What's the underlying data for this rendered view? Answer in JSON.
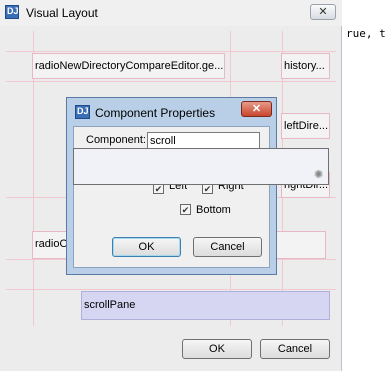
{
  "outer_dialog": {
    "title": "Visual Layout",
    "close_glyph": "✕",
    "cells": {
      "radio_new_dir": "radioNewDirectoryCompareEditor.ge...",
      "history": "history...",
      "left_dir": "leftDire...",
      "right_dir": "rightDir...",
      "radio_o": "radioO",
      "scroll_pane": "scrollPane"
    },
    "ok_label": "OK",
    "cancel_label": "Cancel"
  },
  "inner_dialog": {
    "title": "Component Properties",
    "close_glyph": "✕",
    "component_label": "Component:",
    "component_value": "scroll",
    "left_label": "Left",
    "right_label": "Right",
    "bottom_label": "Bottom",
    "ok_label": "OK",
    "cancel_label": "Cancel",
    "check_glyph": "✔",
    "icon_text": "DJ"
  },
  "popup": {
    "spinner_glyph": "✺"
  },
  "editor": {
    "code_fragment": "rue, t"
  },
  "colors": {
    "grid_line": "#f0c8d0",
    "scroll_pane_bg": "#d6d6f2",
    "inner_frame": "#b9cfe8",
    "close_red": "#c8452d"
  }
}
